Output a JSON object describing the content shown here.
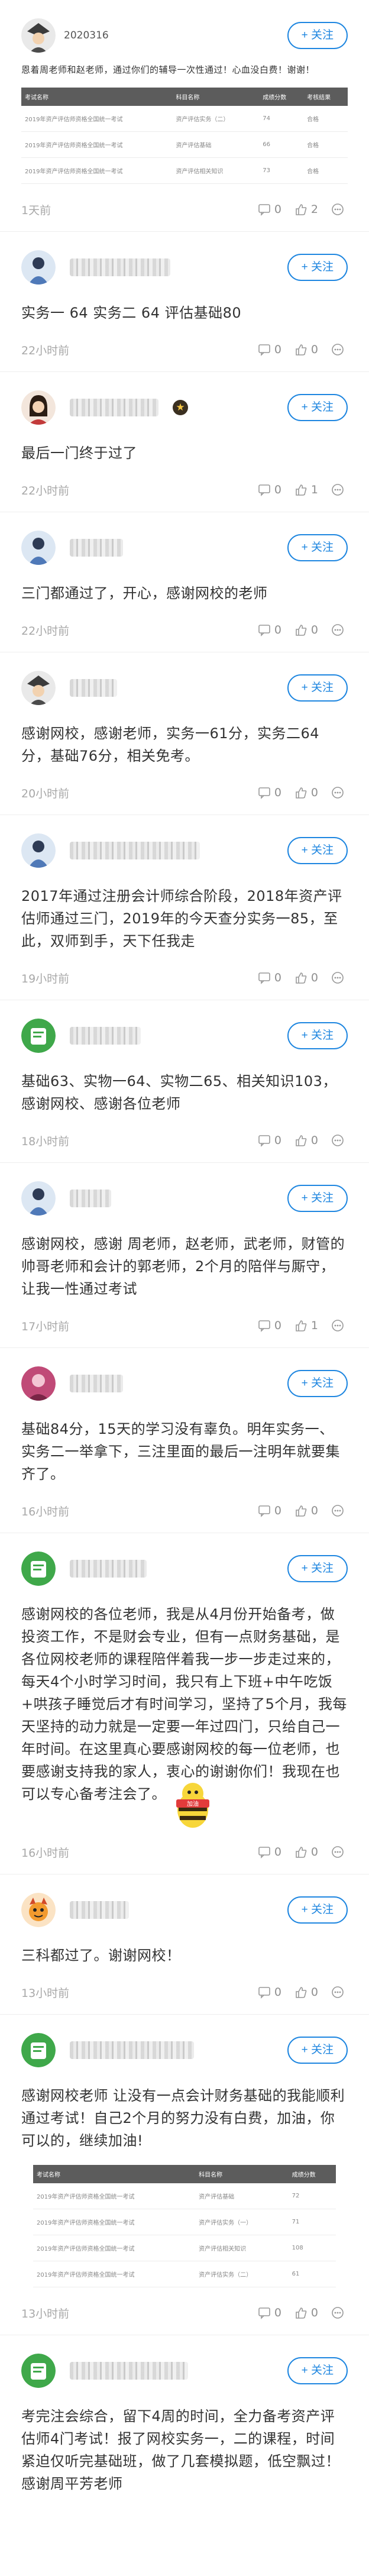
{
  "follow_label": "+ 关注",
  "colors": {
    "accent": "#1e86e0"
  },
  "posts": [
    {
      "user": "2020316",
      "text": "恩着周老师和赵老师，通过你们的辅导一次性通过！心血没白费！谢谢！",
      "table": {
        "headers": [
          "考试名称",
          "科目名称",
          "成绩分数",
          "考核结果"
        ],
        "rows": [
          [
            "2019年资产评估师资格全国统一考试",
            "资产评估实务（二）",
            "74",
            "合格"
          ],
          [
            "2019年资产评估师资格全国统一考试",
            "资产评估基础",
            "66",
            "合格"
          ],
          [
            "2019年资产评估师资格全国统一考试",
            "资产评估相关知识",
            "73",
            "合格"
          ]
        ]
      },
      "time": "1天前",
      "comments": "0",
      "likes": "2"
    },
    {
      "text": "实务一 64  实务二  64 评估基础80",
      "time": "22小时前",
      "comments": "0",
      "likes": "0"
    },
    {
      "text": "最后一门终于过了",
      "time": "22小时前",
      "comments": "0",
      "likes": "1"
    },
    {
      "text": "三门都通过了，开心，感谢网校的老师",
      "time": "22小时前",
      "comments": "0",
      "likes": "0"
    },
    {
      "text": "感谢网校，感谢老师，实务一61分，实务二64分，基础76分，相关免考。",
      "time": "20小时前",
      "comments": "0",
      "likes": "0"
    },
    {
      "text": "2017年通过注册会计师综合阶段，2018年资产评估师通过三门，2019年的今天查分实务一85，至此，双师到手，天下任我走",
      "time": "19小时前",
      "comments": "0",
      "likes": "0"
    },
    {
      "text": "基础63、实物一64、实物二65、相关知识103，感谢网校、感谢各位老师",
      "time": "18小时前",
      "comments": "0",
      "likes": "0"
    },
    {
      "text": "感谢网校，感谢 周老师，赵老师，武老师，财管的帅哥老师和会计的郭老师，2个月的陪伴与厮守，让我一性通过考试",
      "time": "17小时前",
      "comments": "0",
      "likes": "1"
    },
    {
      "text": "基础84分，15天的学习没有辜负。明年实务一、实务二一举拿下，三注里面的最后一注明年就要集齐了。",
      "time": "16小时前",
      "comments": "0",
      "likes": "0"
    },
    {
      "text": "感谢网校的各位老师，我是从4月份开始备考，做投资工作，不是财会专业，但有一点财务基础，是各位网校老师的课程陪伴着我一步一步走过来的，每天4个小时学习时间，我只有上下班+中午吃饭+哄孩子睡觉后才有时间学习，坚持了5个月，我每天坚持的动力就是一定要一年过四门，只给自己一年时间。在这里真心要感谢网校的每一位老师，也要感谢支持我的家人，衷心的谢谢你们！我现在也可以专心备考注会了。",
      "sticker": "加油",
      "time": "16小时前",
      "comments": "0",
      "likes": "0"
    },
    {
      "text": "三科都过了。谢谢网校！",
      "time": "13小时前",
      "comments": "0",
      "likes": "0"
    },
    {
      "text": "感谢网校老师 让没有一点会计财务基础的我能顺利通过考试！自己2个月的努力没有白费，加油，你可以的，继续加油!",
      "table": {
        "headers": [
          "考试名称",
          "科目名称",
          "成绩分数"
        ],
        "rows": [
          [
            "2019年资产评估师资格全国统一考试",
            "资产评估基础",
            "72"
          ],
          [
            "2019年资产评估师资格全国统一考试",
            "资产评估实务（一）",
            "71"
          ],
          [
            "2019年资产评估师资格全国统一考试",
            "资产评估相关知识",
            "108"
          ],
          [
            "2019年资产评估师资格全国统一考试",
            "资产评估实务（二）",
            "61"
          ]
        ]
      },
      "time": "13小时前",
      "comments": "0",
      "likes": "0"
    },
    {
      "text": "考完注会综合，留下4周的时间，全力备考资产评估师4门考试！报了网校实务一，二的课程，时间紧迫仅听完基础班，做了几套模拟题，低空飘过！感谢周平芳老师",
      "time": "",
      "comments": "",
      "likes": ""
    }
  ]
}
